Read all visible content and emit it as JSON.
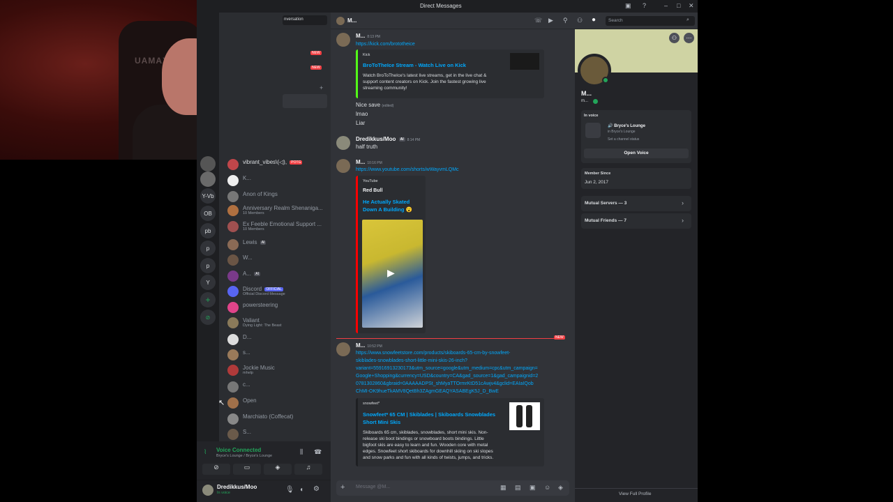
{
  "window": {
    "title": "Direct Messages"
  },
  "rail": {
    "labels": [
      "Y-Vb",
      "OB",
      "pb",
      "p",
      "p",
      "Y"
    ]
  },
  "sidebar": {
    "tab_fragment": "nversation",
    "new_badge": "NEW",
    "dms": [
      {
        "name": "vibrant_vibes\\(◁),",
        "tag": "POTG"
      },
      {
        "name": "K..."
      },
      {
        "name": "Anon of Kings"
      },
      {
        "name": "Anniversary Realm Shenaniga...",
        "sub": "10 Members"
      },
      {
        "name": "Ex Feeble Emotional Support ...",
        "sub": "10 Members"
      },
      {
        "name": "Lewis",
        "tag": "AI"
      },
      {
        "name": "W..."
      },
      {
        "name": "A...",
        "tag": "AI"
      },
      {
        "name": "Discord",
        "tag": "OFFICIAL",
        "sub": "Official Discord Message"
      },
      {
        "name": "powersteering"
      },
      {
        "name": "Valiant",
        "sub": "Dying Light: The Beast"
      },
      {
        "name": "D..."
      },
      {
        "name": "s..."
      },
      {
        "name": "Jockie Music",
        "sub": "mhelp"
      },
      {
        "name": "c..."
      },
      {
        "name": "Open"
      },
      {
        "name": "Marchiato (Coffecat)"
      },
      {
        "name": "S..."
      }
    ]
  },
  "voice": {
    "status": "Voice Connected",
    "channel": "Bryce's Lounge / Bryce's Lounge"
  },
  "user": {
    "name": "Dredikkus/Moo",
    "status": "In voice"
  },
  "chat": {
    "header_name": "M...",
    "search_placeholder": "Search",
    "composer_placeholder": "Message @M...",
    "new_divider": "NEW",
    "messages": {
      "m1": {
        "author": "M...",
        "time": "8:13 PM",
        "link": "https://kick.com/brototheice",
        "embed": {
          "provider": "Kick",
          "title": "BroToTheIce Stream - Watch Live on Kick",
          "desc": [
            "Watch BroToTheIce's latest live streams, get in the live chat &",
            "support content creators on Kick. Join the fastest growing live",
            "streaming community!"
          ]
        }
      },
      "m1_lines": [
        {
          "text": "Nice save",
          "edited": "(edited)"
        },
        {
          "text": "lmao"
        },
        {
          "text": "Liar"
        }
      ],
      "m2": {
        "author": "Dredikkus/Moo",
        "tag": "AI",
        "time": "8:14 PM",
        "text": "half truth"
      },
      "m3": {
        "author": "M...",
        "time": "10:16 PM",
        "link": "https://www.youtube.com/shorts/wWayvmLQMc",
        "embed": {
          "provider": "YouTube",
          "channel": "Red Bull",
          "title": "He Actually Skated Down A Building 😮"
        }
      },
      "m4": {
        "author": "M...",
        "time": "10:52 PM",
        "link_lines": [
          "https://www.snowfeetstore.com/products/skiboards-65-cm-by-snowfeet-",
          "skiblades-snowblades-short-little-mini-skis-26-inch?",
          "variant=55916913230173&utm_source=google&utm_medium=cpc&utm_campaign=",
          "Google+Shopping&currency=USD&country=CA&gad_source=1&gad_campaignid=2",
          "0781302860&gbraid=0AAAAADPSt_shMyaTTOrmrKtD51cAwjv4&gclid=EAIaIQob",
          "ChMI-OK9hueTkAMV8QetBh3ZAgmGEAQYASABEgK5J_D_BwE"
        ],
        "embed": {
          "provider": "snowfeet*",
          "title_lines": [
            "Snowfeet* 65 CM | Skiblades | Skiboards Snowblades",
            "Short Mini Skis"
          ],
          "desc": [
            "Skiboards 65 cm, skiblades, snowblades, short mini skis. Non-",
            "release ski boot bindings or snowboard boots bindings. Little",
            "bigfoot skis are easy to learn and fun. Wooden core with metal",
            "edges. Snowfeet short skiboards for downhill skiing on ski slopes",
            "and snow parks and fun with all kinds of twists, jumps, and tricks."
          ]
        }
      }
    }
  },
  "profile": {
    "display_name": "M...",
    "username": "m...",
    "in_voice_label": "In voice",
    "voice_channel": "Bryce's Lounge",
    "voice_sub": "in Bryce's Lounge",
    "channel_status": "Set a channel status",
    "open_voice": "Open Voice",
    "member_since_label": "Member Since",
    "member_since": "Jun 2, 2017",
    "mutual_servers": "Mutual Servers — 3",
    "mutual_friends": "Mutual Friends — 7",
    "view_full": "View Full Profile"
  },
  "colors": {
    "accent": "#5865f2",
    "link": "#00a8fc",
    "online": "#23a55a",
    "danger": "#f23f43",
    "banner": "#cfd3a3"
  }
}
